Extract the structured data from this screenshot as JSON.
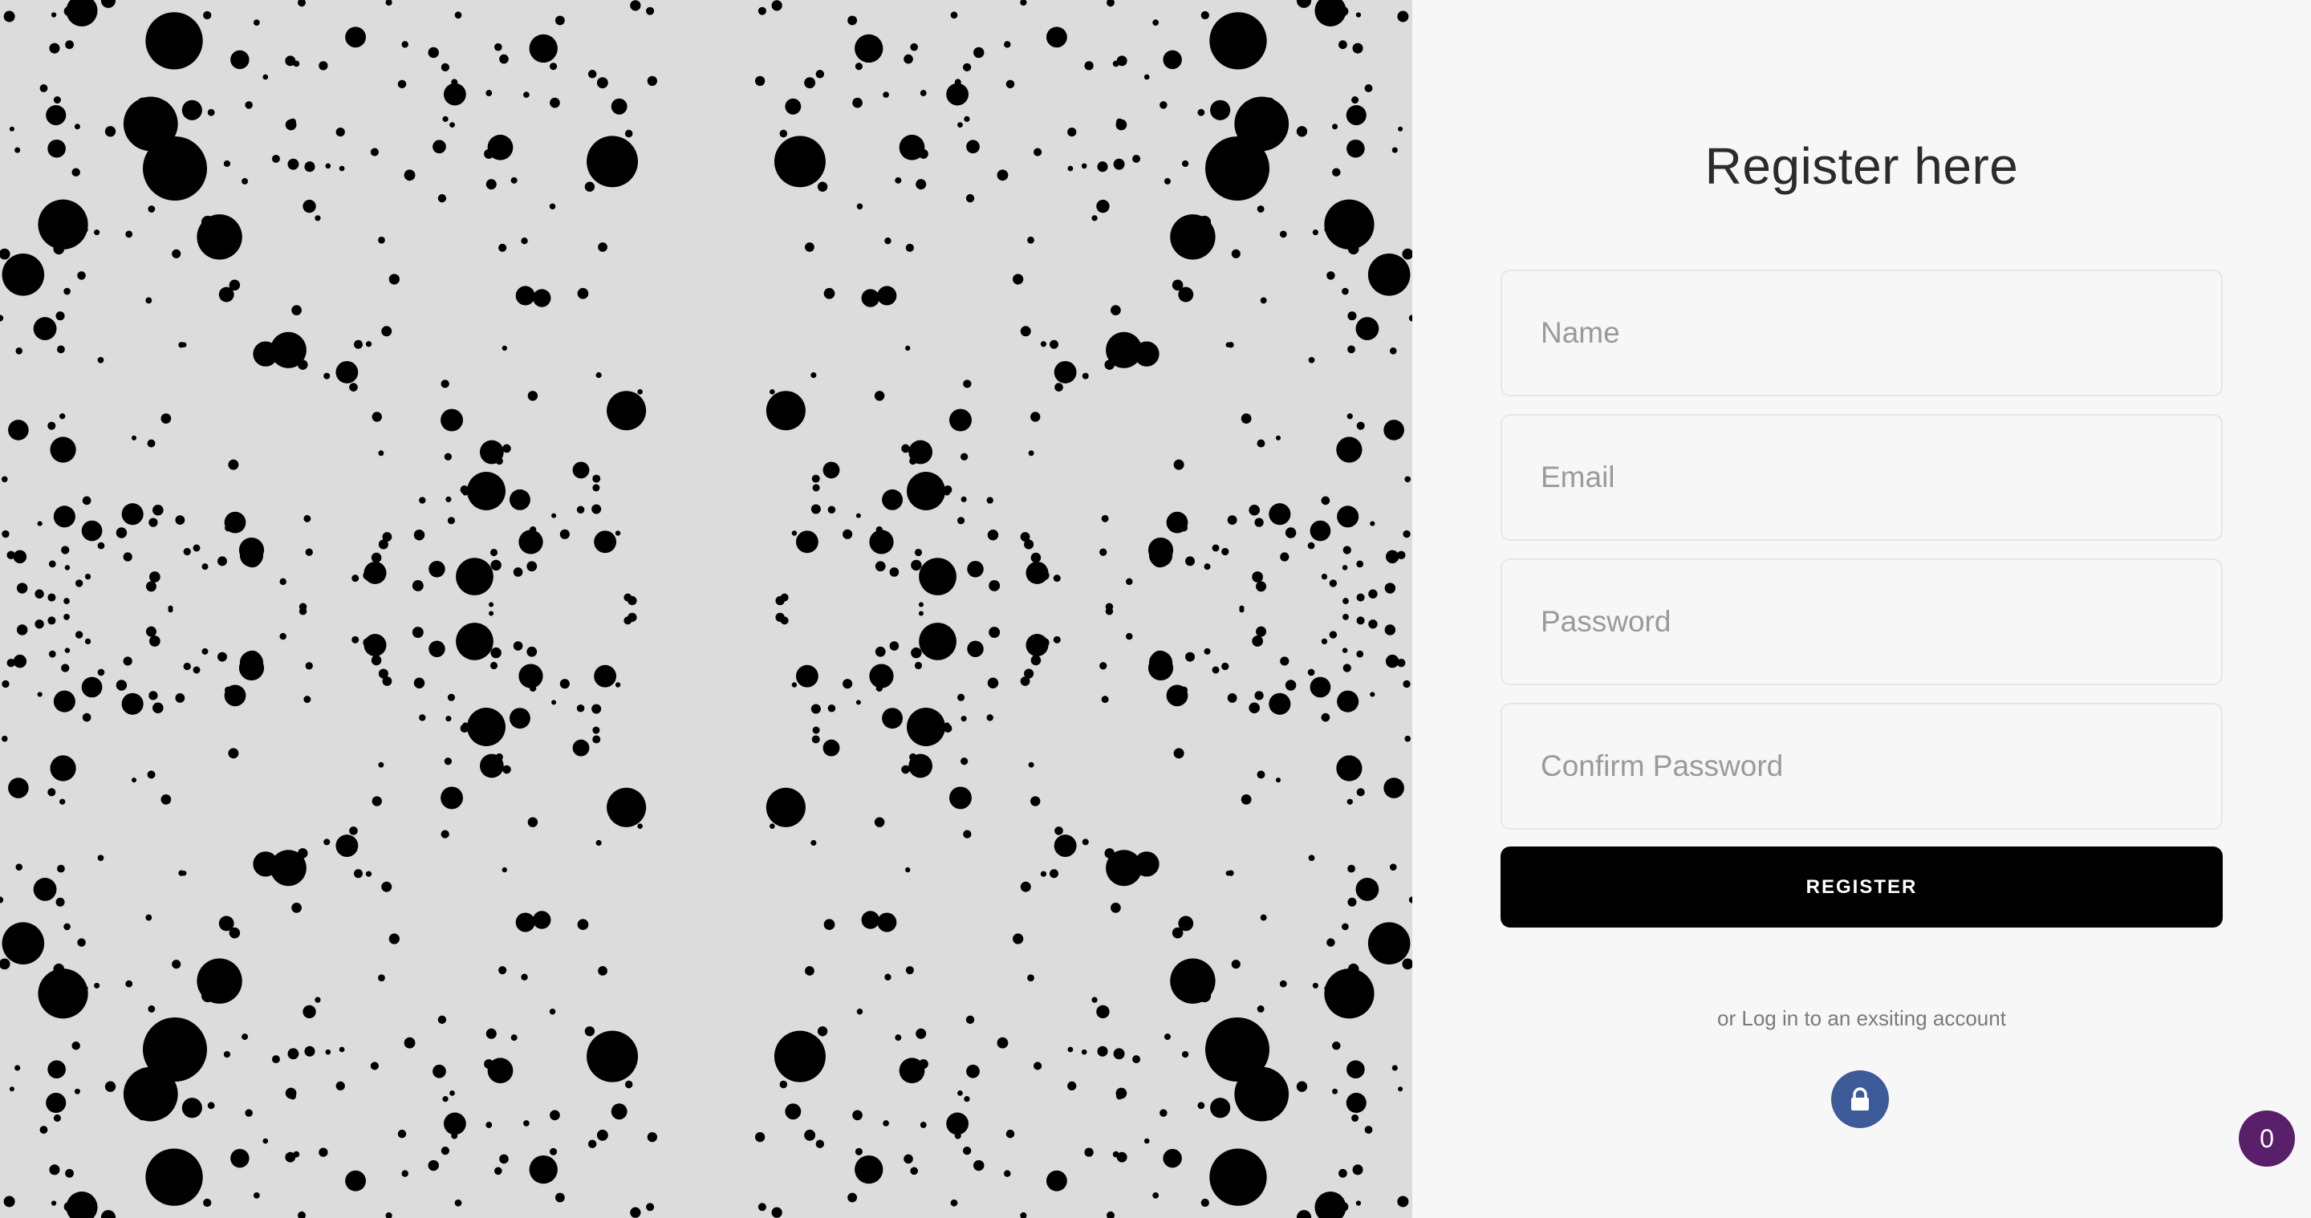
{
  "form": {
    "title": "Register here",
    "name_placeholder": "Name",
    "email_placeholder": "Email",
    "password_placeholder": "Password",
    "confirm_placeholder": "Confirm Password",
    "register_label": "REGISTER",
    "login_link": "or Log in to an exsiting account"
  },
  "badge": {
    "count": "0"
  },
  "colors": {
    "lock_button": "#3d5a99",
    "badge": "#5a1f6b",
    "register_button": "#000000"
  },
  "icons": {
    "lock": "lock-icon"
  }
}
